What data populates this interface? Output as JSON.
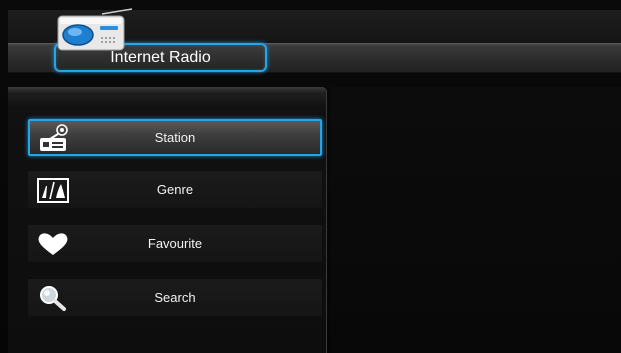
{
  "header": {
    "title": "Internet Radio"
  },
  "menu": {
    "items": [
      {
        "label": "Station",
        "icon": "radio-station-icon",
        "selected": true
      },
      {
        "label": "Genre",
        "icon": "genre-icon",
        "selected": false
      },
      {
        "label": "Favourite",
        "icon": "heart-icon",
        "selected": false
      },
      {
        "label": "Search",
        "icon": "magnifier-icon",
        "selected": false
      }
    ]
  },
  "colors": {
    "accent": "#25a5e8",
    "background": "#000000",
    "text": "#ffffff"
  }
}
